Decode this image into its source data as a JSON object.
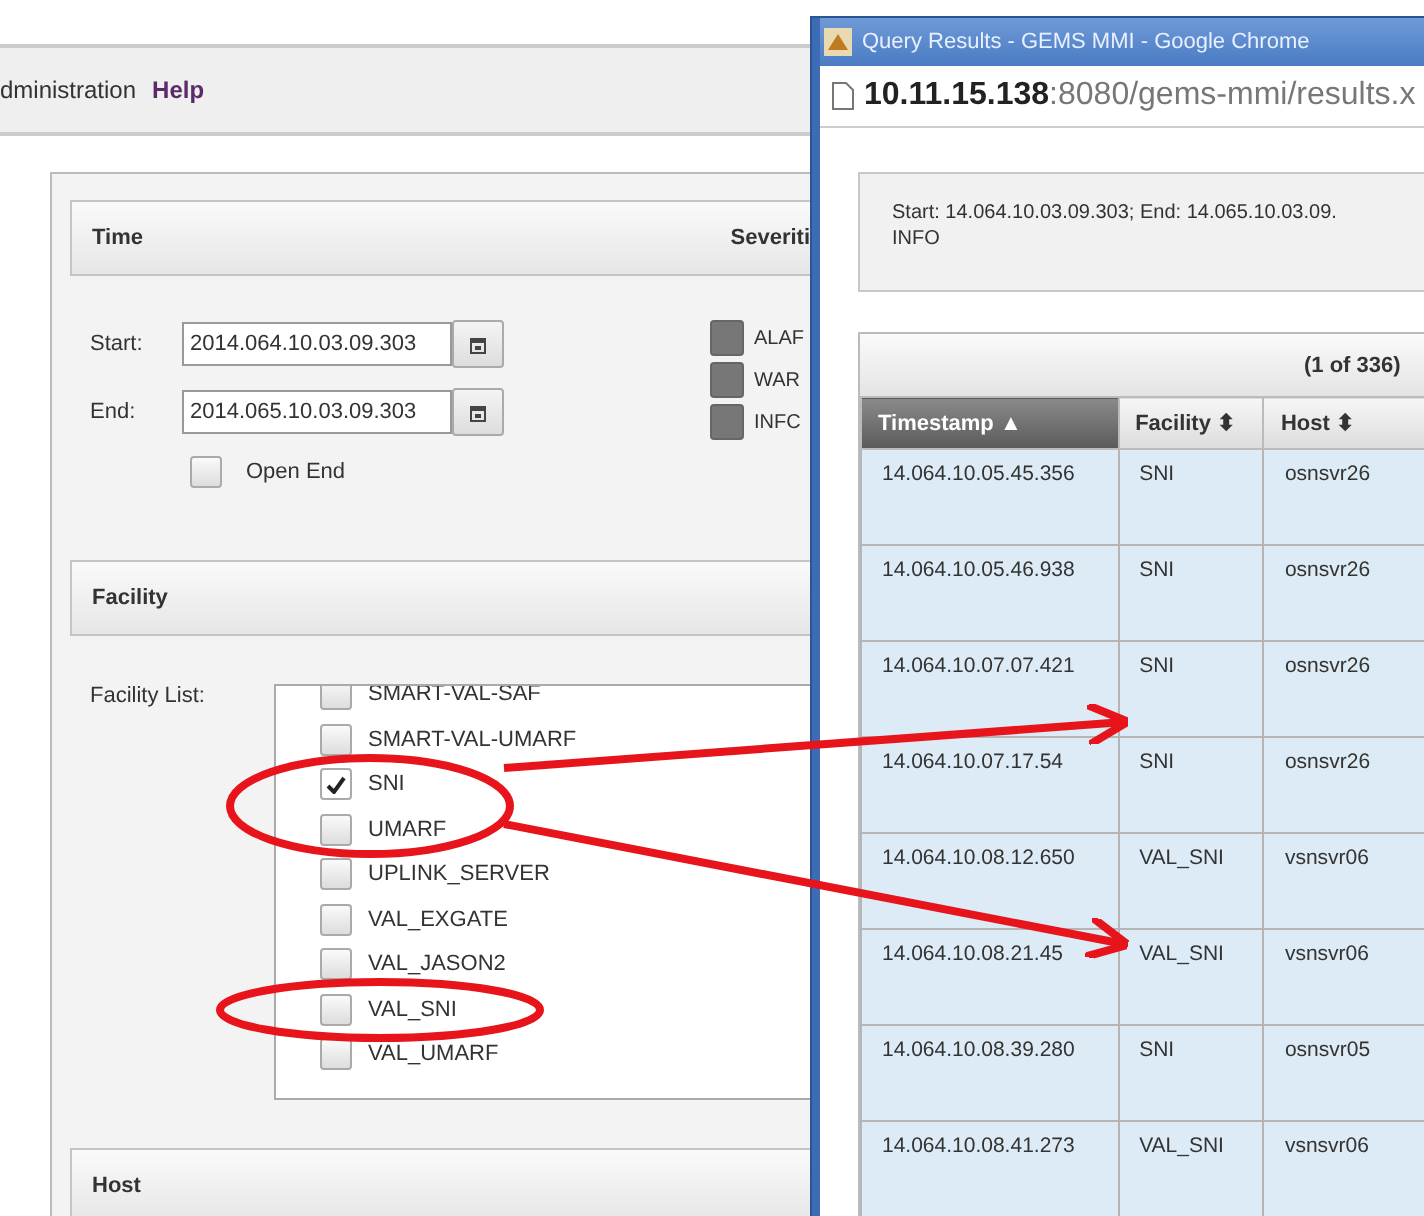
{
  "menu": [
    "dministration",
    "Help"
  ],
  "time_panel": {
    "title": "Time",
    "severity_title": "Severiti",
    "start": {
      "label": "Start:",
      "value": "2014.064.10.03.09.303"
    },
    "end": {
      "label": "End:",
      "value": "2014.065.10.03.09.303"
    },
    "open_end": {
      "label": "Open End",
      "checked": false
    },
    "severities": [
      {
        "label": "ALAF",
        "checked": false
      },
      {
        "label": "WAR",
        "checked": false
      },
      {
        "label": "INFC",
        "checked": false
      }
    ]
  },
  "facility_panel": {
    "title": "Facility",
    "list_label": "Facility List:",
    "items": [
      {
        "label": "SMART-VAL-SAF",
        "checked": false
      },
      {
        "label": "SMART-VAL-UMARF",
        "checked": false
      },
      {
        "label": "SNI",
        "checked": true
      },
      {
        "label": "UMARF",
        "checked": false
      },
      {
        "label": "UPLINK_SERVER",
        "checked": false
      },
      {
        "label": "VAL_EXGATE",
        "checked": false
      },
      {
        "label": "VAL_JASON2",
        "checked": false
      },
      {
        "label": "VAL_SNI",
        "checked": false
      },
      {
        "label": "VAL_UMARF",
        "checked": false
      }
    ]
  },
  "host_panel": {
    "title": "Host"
  },
  "popup": {
    "title": "Query Results - GEMS MMI - Google Chrome",
    "url_host": "10.11.15.138",
    "url_rest": ":8080/gems-mmi/results.x",
    "summary": [
      "Start: 14.064.10.03.09.303; End: 14.065.10.03.09.",
      "INFO"
    ],
    "pager": "(1 of 336)",
    "columns": [
      {
        "label": "Timestamp",
        "sort": "▲",
        "selected": true
      },
      {
        "label": "Facility",
        "sort": "⬍",
        "selected": false
      },
      {
        "label": "Host",
        "sort": "⬍",
        "selected": false
      }
    ],
    "rows": [
      [
        "14.064.10.05.45.356",
        "SNI",
        "osnsvr26"
      ],
      [
        "14.064.10.05.46.938",
        "SNI",
        "osnsvr26"
      ],
      [
        "14.064.10.07.07.421",
        "SNI",
        "osnsvr26"
      ],
      [
        "14.064.10.07.17.54",
        "SNI",
        "osnsvr26"
      ],
      [
        "14.064.10.08.12.650",
        "VAL_SNI",
        "vsnsvr06"
      ],
      [
        "14.064.10.08.21.45",
        "VAL_SNI",
        "vsnsvr06"
      ],
      [
        "14.064.10.08.39.280",
        "SNI",
        "osnsvr05"
      ],
      [
        "14.064.10.08.41.273",
        "VAL_SNI",
        "vsnsvr06"
      ]
    ]
  }
}
